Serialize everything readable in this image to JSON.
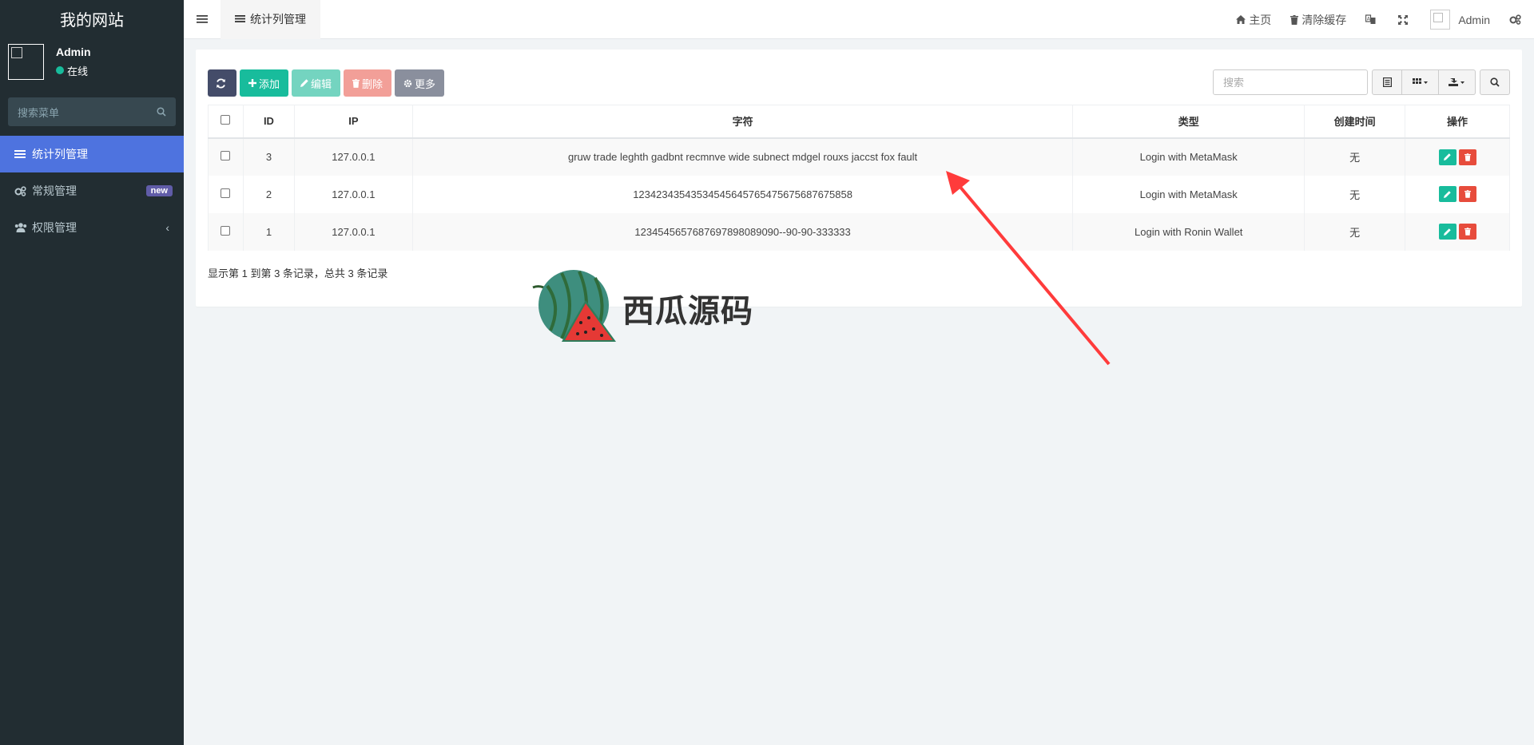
{
  "sidebar": {
    "logo": "我的网站",
    "user_name": "Admin",
    "user_status": "在线",
    "search_placeholder": "搜索菜单",
    "items": [
      {
        "label": "统计列管理",
        "active": true
      },
      {
        "label": "常规管理",
        "badge": "new"
      },
      {
        "label": "权限管理"
      }
    ]
  },
  "header": {
    "tab_label": "统计列管理",
    "home": "主页",
    "clear_cache": "清除缓存",
    "user": "Admin"
  },
  "toolbar": {
    "add": "添加",
    "edit": "编辑",
    "delete": "删除",
    "more": "更多",
    "search_placeholder": "搜索"
  },
  "table": {
    "columns": [
      "ID",
      "IP",
      "字符",
      "类型",
      "创建时间",
      "操作"
    ],
    "rows": [
      {
        "id": "3",
        "ip": "127.0.0.1",
        "text": "gruw trade leghth gadbnt recmnve wide subnect mdgel rouxs jaccst fox fault",
        "type": "Login with MetaMask",
        "created": "无"
      },
      {
        "id": "2",
        "ip": "127.0.0.1",
        "text": "12342343543534545645765475675687675858",
        "type": "Login with MetaMask",
        "created": "无"
      },
      {
        "id": "1",
        "ip": "127.0.0.1",
        "text": "12345456576876978980890​90--90-90-333333",
        "type": "Login with Ronin Wallet",
        "created": "无"
      }
    ],
    "footer": "显示第 1 到第 3 条记录，总共 3 条记录"
  },
  "watermark": {
    "text": "西瓜源码"
  },
  "colors": {
    "sidebar_bg": "#222d32",
    "active_menu": "#4e73df",
    "primary": "#18bc9c",
    "danger": "#e74c3c"
  }
}
